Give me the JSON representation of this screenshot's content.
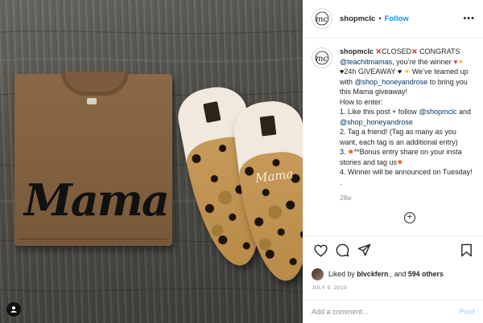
{
  "account": {
    "username": "shopmclc",
    "follow_label": "Follow",
    "separator": "•",
    "more": "•••"
  },
  "photo": {
    "shirt_print": "Mama",
    "shoe_print": "Mama"
  },
  "caption": {
    "username": "shopmclc",
    "closed": "CLOSED",
    "congrats": "CONGRATS",
    "winner_mention": "@teachitmamas",
    "winner_text": ", you’re the winner",
    "giveaway": "24h GIVEAWAY",
    "teamed_text": "We’ve teamed up with",
    "partner_mention": "@shop_honeyandrose",
    "bring_text": "to bring you this Mama giveaway!",
    "how_to": "How to enter:",
    "step1_a": "1. Like this post + follow",
    "step1_mention1": "@shopmclc",
    "step1_and": "and",
    "step1_mention2": "@shop_honeyandrose",
    "step2": "2. Tag a friend! (Tag as many as you want, each tag is an additional entry)",
    "step3_a": "3.",
    "step3_b": "**Bonus entry share on your insta stories and tag us",
    "step4": "4. Winner will be announced on Tuesday!",
    "end": ".",
    "time": "28w"
  },
  "likes": {
    "prefix": "Liked by",
    "user": "blvckfern_",
    "and": "and",
    "count": "594 others"
  },
  "date": "JULY 9, 2019",
  "comment": {
    "placeholder": "Add a comment...",
    "post_label": "Post"
  },
  "icons": [
    "heart-icon",
    "comment-icon",
    "share-icon",
    "bookmark-icon",
    "more-icon",
    "add-icon"
  ],
  "colors": {
    "link": "#0095f6",
    "mention": "#00376b",
    "muted": "#8e8e8e",
    "post_disabled": "#b3dbff"
  }
}
